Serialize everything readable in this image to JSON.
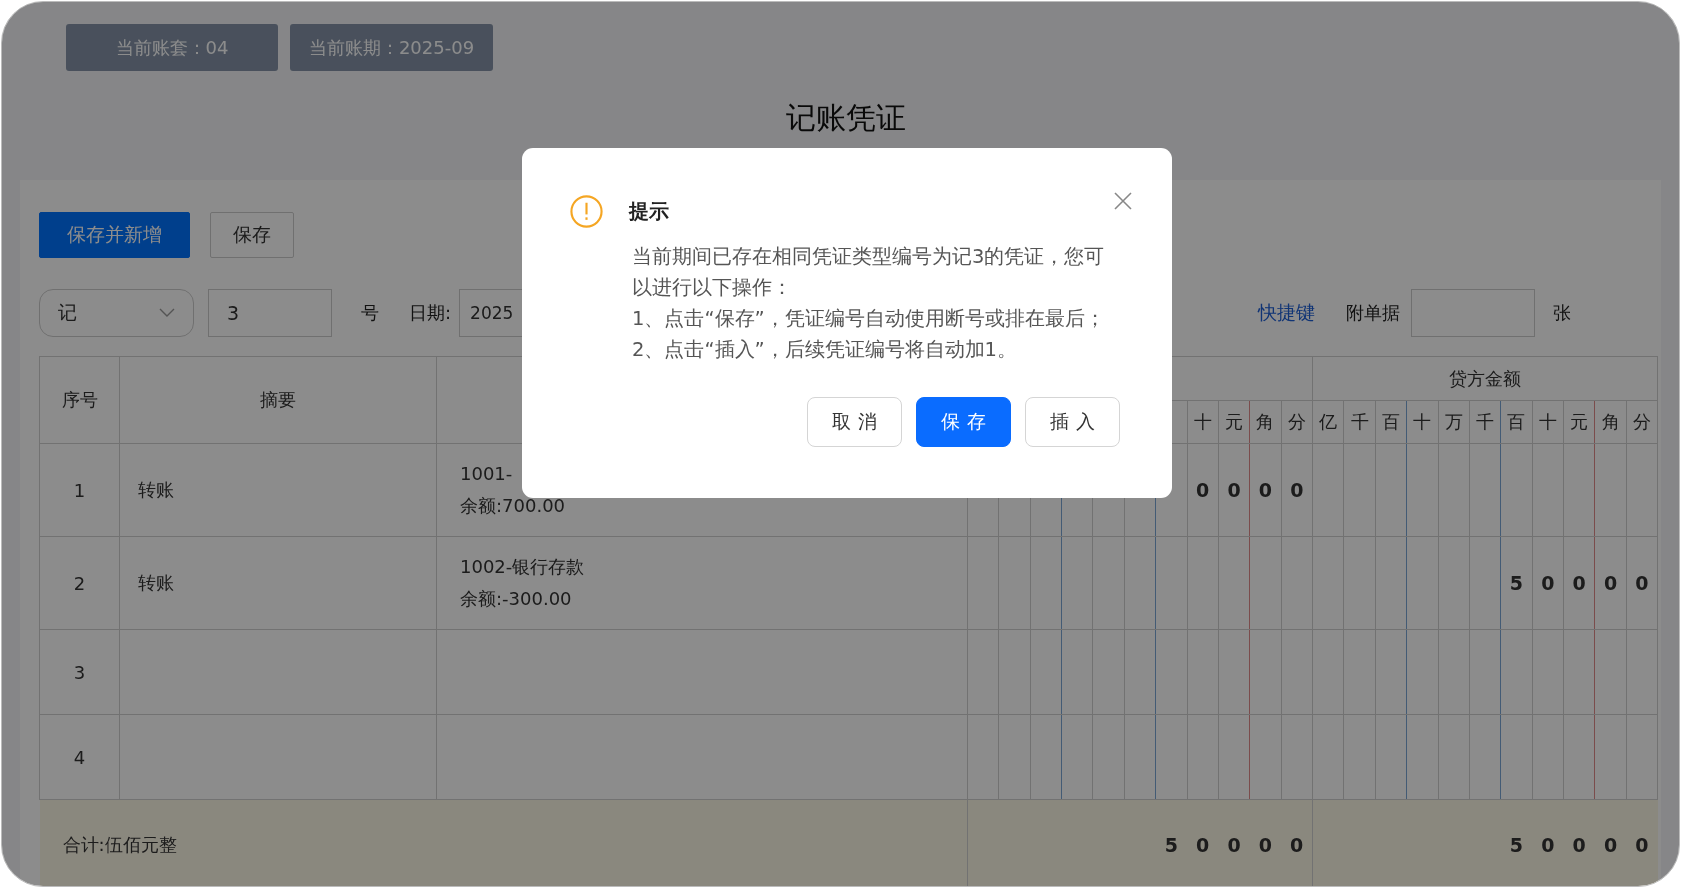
{
  "header_tags": [
    "当前账套：04",
    "当前账期：2025-09"
  ],
  "title": "记账凭证",
  "toolbar": {
    "buttons": [
      {
        "label": "保存并新增",
        "kind": "primary"
      },
      {
        "label": "保存",
        "kind": "default"
      }
    ]
  },
  "voucher_form": {
    "type_select": "记",
    "number": "3",
    "number_suffix": "号",
    "date_label": "日期:",
    "date_value": "2025",
    "shortcut_link": "快捷键",
    "attachments_label": "附单据",
    "attachments_unit": "张"
  },
  "table": {
    "columns": [
      "序号",
      "摘要"
    ],
    "credit_header": "贷方金额",
    "debit_digit_labels": [
      "十",
      "元",
      "角",
      "分"
    ],
    "credit_digit_labels": [
      "亿",
      "千",
      "百",
      "十",
      "万",
      "千",
      "百",
      "十",
      "元",
      "角",
      "分"
    ],
    "rows": [
      {
        "no": "1",
        "summary": "转账",
        "account": "1001-",
        "balance": "余额:700.00",
        "debit": [
          "0",
          "0",
          "0",
          "0"
        ]
      },
      {
        "no": "2",
        "summary": "转账",
        "account": "1002-银行存款",
        "balance": "余额:-300.00",
        "credit": [
          "5",
          "0",
          "0",
          "0",
          "0"
        ]
      },
      {
        "no": "3"
      },
      {
        "no": "4"
      }
    ],
    "total": {
      "label": "合计:伍佰元整",
      "debit": [
        "5",
        "0",
        "0",
        "0",
        "0"
      ],
      "credit": [
        "5",
        "0",
        "0",
        "0",
        "0"
      ]
    }
  },
  "dialog": {
    "title": "提示",
    "paragraphs": [
      "当前期间已存在相同凭证类型编号为记3的凭证，您可以进行以下操作：",
      "1、点击“保存”，凭证编号自动使用断号或排在最后；",
      "2、点击“插入”，后续凭证编号将自动加1。"
    ],
    "buttons": [
      {
        "label": "取 消",
        "kind": "default"
      },
      {
        "label": "保 存",
        "kind": "primary"
      },
      {
        "label": "插 入",
        "kind": "default"
      }
    ]
  }
}
